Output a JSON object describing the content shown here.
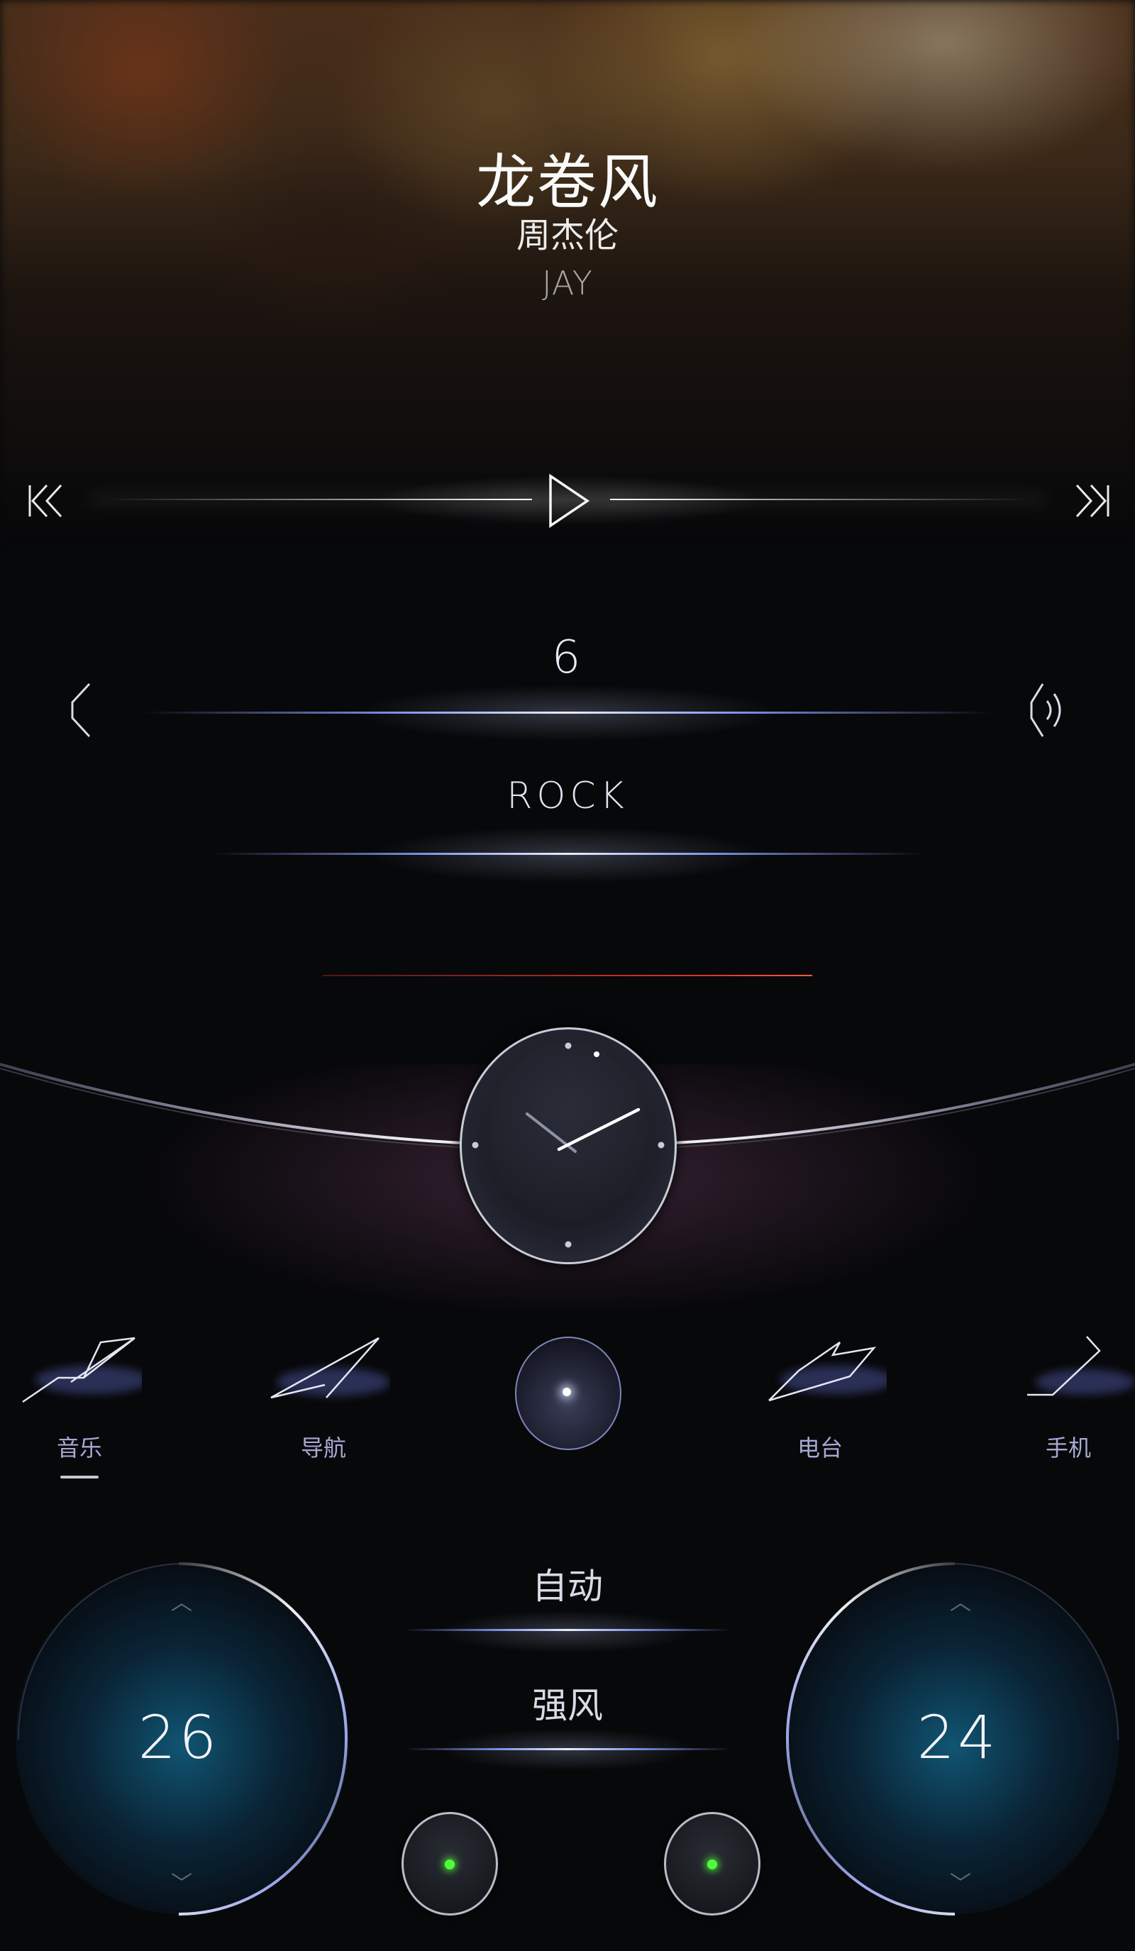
{
  "song": {
    "title": "龙卷风",
    "artist": "周杰伦",
    "artist_en": "JAY"
  },
  "player": {
    "prev_icon": "skip-previous-icon",
    "play_icon": "play-icon",
    "next_icon": "skip-next-icon"
  },
  "volume": {
    "level": "6",
    "genre": "ROCK",
    "left_icon": "chevron-left-icon",
    "right_icon": "speaker-icon"
  },
  "nav": {
    "items": [
      {
        "label": "音乐",
        "icon": "music-wedge-icon",
        "active": true
      },
      {
        "label": "导航",
        "icon": "navigation-wedge-icon",
        "active": false
      },
      {
        "label": "电台",
        "icon": "radio-wedge-icon",
        "active": false
      },
      {
        "label": "手机",
        "icon": "phone-wedge-icon",
        "active": false
      }
    ]
  },
  "climate": {
    "left_temp": "26",
    "right_temp": "24",
    "mode": "自动",
    "fan": "强风"
  },
  "colors": {
    "accent_blue": "#8ea0ff",
    "label_lavender": "#a7a9d4",
    "led_green": "#4cff3a",
    "red_indicator": "#d93a2a",
    "dial_teal": "#146e96"
  }
}
